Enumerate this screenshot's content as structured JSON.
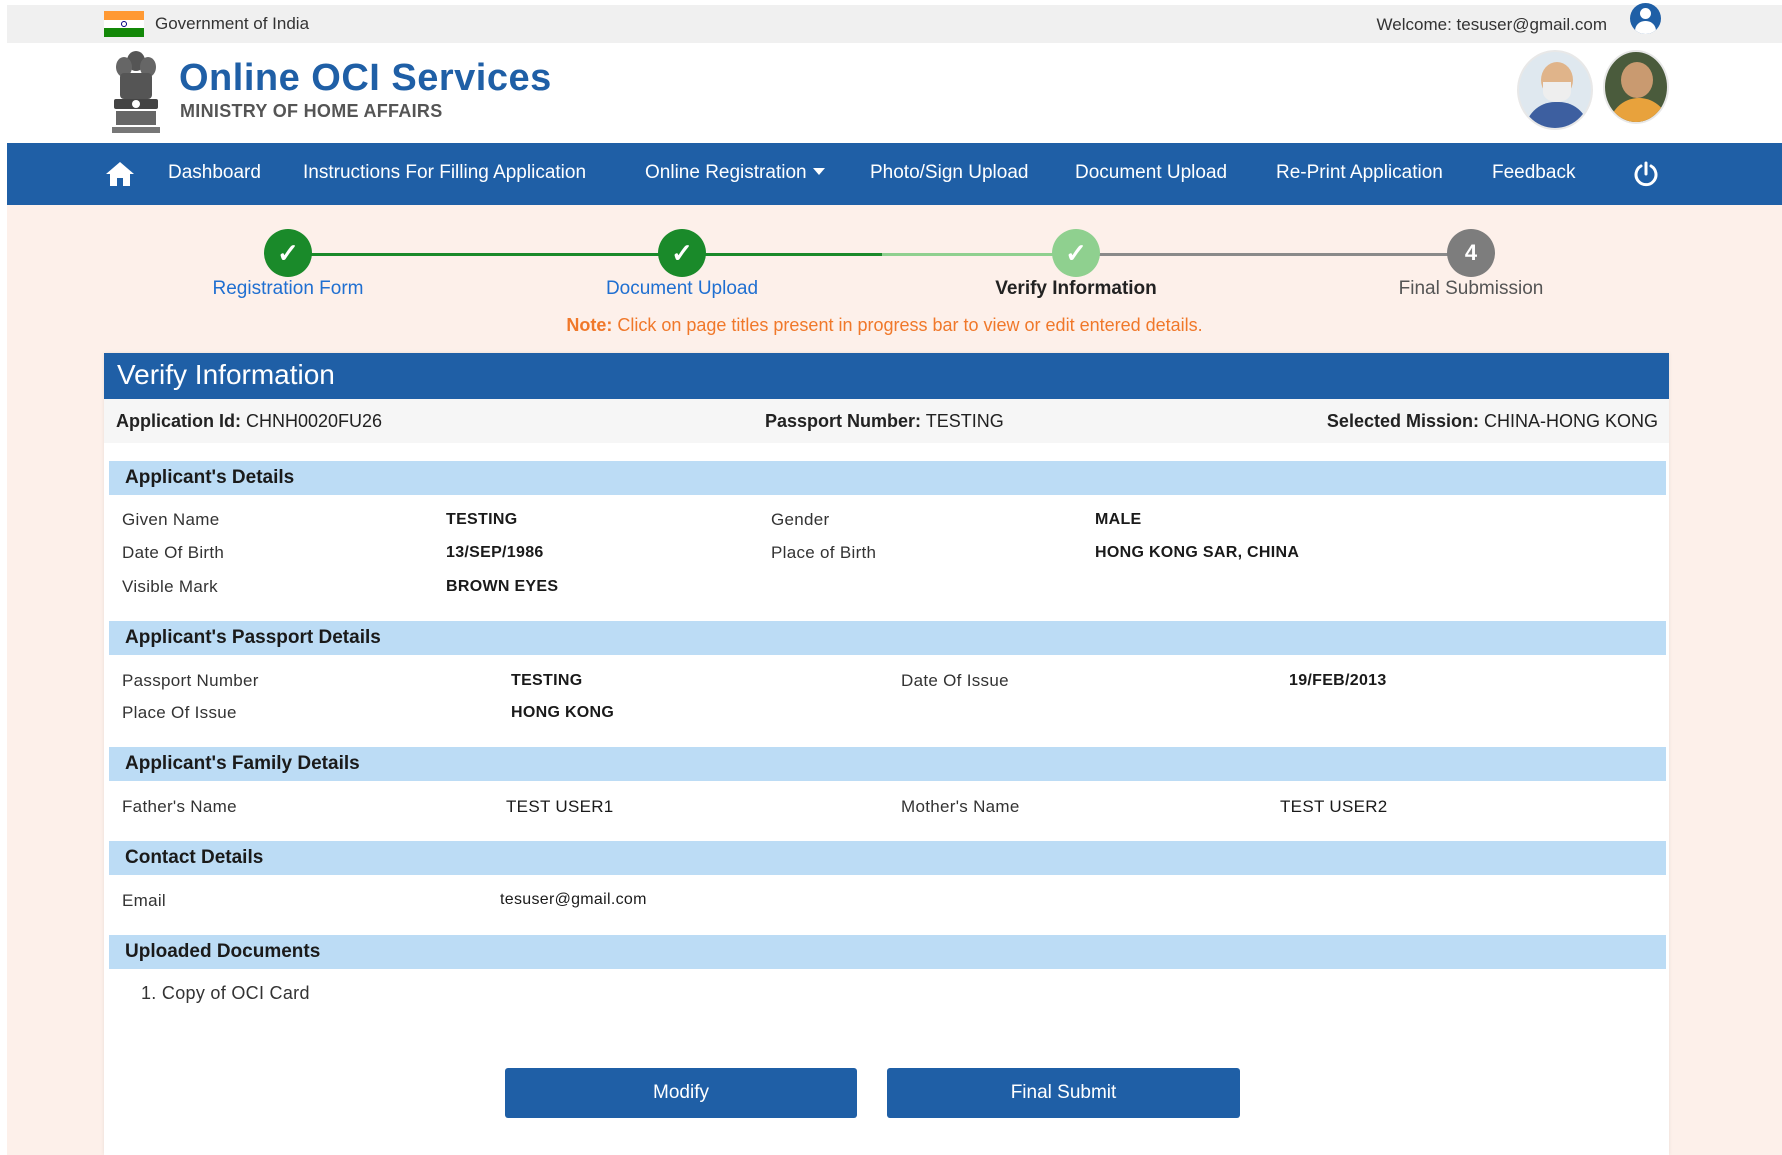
{
  "topbar": {
    "gov_label": "Government of India",
    "welcome_label": "Welcome:",
    "user_email": "tesuser@gmail.com"
  },
  "header": {
    "title": "Online OCI Services",
    "subtitle": "MINISTRY OF HOME AFFAIRS"
  },
  "nav": {
    "items": [
      "Dashboard",
      "Instructions For Filling Application",
      "Online Registration",
      "Photo/Sign Upload",
      "Document Upload",
      "Re-Print Application",
      "Feedback"
    ]
  },
  "progress": {
    "steps": [
      {
        "label": "Registration Form",
        "status": "done",
        "mark": "✓"
      },
      {
        "label": "Document Upload",
        "status": "done",
        "mark": "✓"
      },
      {
        "label": "Verify Information",
        "status": "active",
        "mark": "✓"
      },
      {
        "label": "Final Submission",
        "status": "pending",
        "mark": "4"
      }
    ],
    "note_label": "Note:",
    "note_text": "Click on page titles present in progress bar to view or edit entered details."
  },
  "verify": {
    "title": "Verify Information",
    "app_id_label": "Application Id:",
    "app_id": "CHNH0020FU26",
    "passport_label": "Passport Number:",
    "passport": "TESTING",
    "mission_label": "Selected Mission:",
    "mission": "CHINA-HONG KONG"
  },
  "applicant": {
    "heading": "Applicant's Details",
    "given_name_label": "Given Name",
    "given_name": "TESTING",
    "gender_label": "Gender",
    "gender": "MALE",
    "dob_label": "Date Of Birth",
    "dob": "13/SEP/1986",
    "pob_label": "Place of Birth",
    "pob": "HONG KONG SAR, CHINA",
    "mark_label": "Visible Mark",
    "mark": "BROWN EYES"
  },
  "passport": {
    "heading": "Applicant's Passport Details",
    "number_label": "Passport Number",
    "number": "TESTING",
    "issue_date_label": "Date Of Issue",
    "issue_date": "19/FEB/2013",
    "issue_place_label": "Place Of Issue",
    "issue_place": "HONG KONG"
  },
  "family": {
    "heading": "Applicant's Family Details",
    "father_label": "Father's Name",
    "father": "TEST USER1",
    "mother_label": "Mother's Name",
    "mother": "TEST USER2"
  },
  "contact": {
    "heading": "Contact Details",
    "email_label": "Email",
    "email": "tesuser@gmail.com"
  },
  "documents": {
    "heading": "Uploaded Documents",
    "items": [
      "1. Copy of OCI Card"
    ]
  },
  "actions": {
    "modify": "Modify",
    "final_submit": "Final Submit"
  },
  "colors": {
    "primary": "#1f5fa6",
    "section_bg": "#bcdcf5",
    "success": "#1a8a2a",
    "note": "#f0782a",
    "content_bg": "#fdf0ea"
  }
}
